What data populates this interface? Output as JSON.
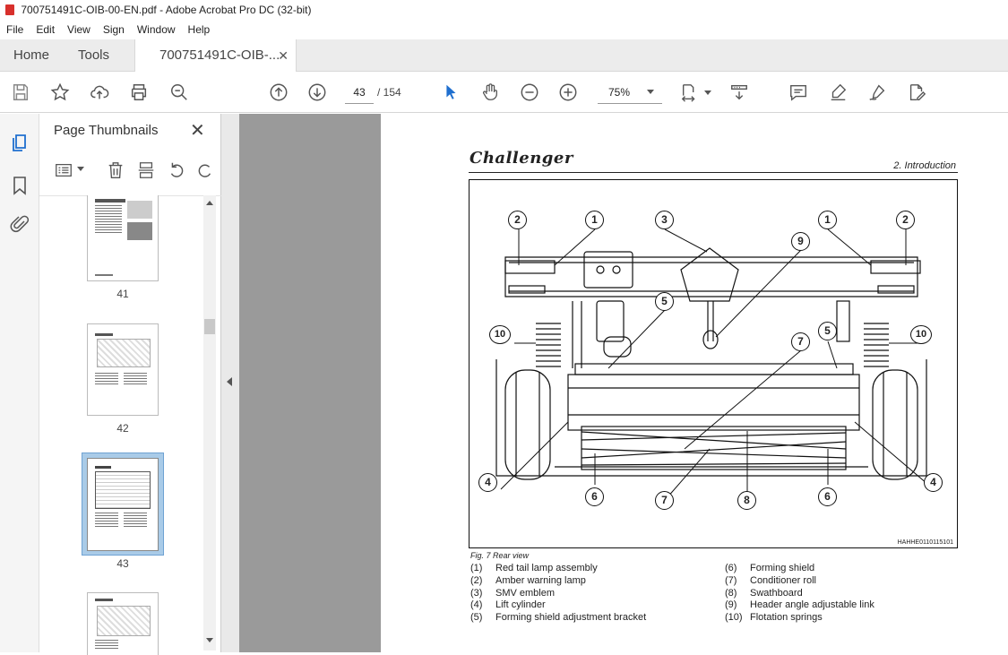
{
  "window": {
    "title": "700751491C-OIB-00-EN.pdf - Adobe Acrobat Pro DC (32-bit)"
  },
  "menu": [
    "File",
    "Edit",
    "View",
    "Sign",
    "Window",
    "Help"
  ],
  "tabs": {
    "home": "Home",
    "tools": "Tools",
    "document": "700751491C-OIB-..."
  },
  "toolbar": {
    "current_page": "43",
    "total_pages": "/ 154",
    "zoom": "75%"
  },
  "panel": {
    "title": "Page Thumbnails",
    "thumbnails": [
      {
        "label": "41",
        "state": "normal"
      },
      {
        "label": "42",
        "state": "normal"
      },
      {
        "label": "43",
        "state": "selected"
      },
      {
        "label": "",
        "state": "normal"
      }
    ]
  },
  "document": {
    "logo": "Challenger",
    "section": "2. Introduction",
    "figure_id": "HAHHE0110115101",
    "caption": "Fig. 7  Rear view",
    "callouts": [
      "2",
      "1",
      "3",
      "1",
      "2",
      "9",
      "5",
      "10",
      "10",
      "7",
      "5",
      "4",
      "6",
      "7",
      "8",
      "6",
      "4"
    ],
    "legend_left": [
      {
        "num": "(1)",
        "text": "Red tail lamp assembly"
      },
      {
        "num": "(2)",
        "text": "Amber warning lamp"
      },
      {
        "num": "(3)",
        "text": "SMV emblem"
      },
      {
        "num": "(4)",
        "text": "Lift cylinder"
      },
      {
        "num": "(5)",
        "text": "Forming shield adjustment bracket"
      }
    ],
    "legend_right": [
      {
        "num": "(6)",
        "text": "Forming shield"
      },
      {
        "num": "(7)",
        "text": "Conditioner roll"
      },
      {
        "num": "(8)",
        "text": "Swathboard"
      },
      {
        "num": "(9)",
        "text": "Header angle adjustable link"
      },
      {
        "num": "(10)",
        "text": "Flotation springs"
      }
    ]
  }
}
